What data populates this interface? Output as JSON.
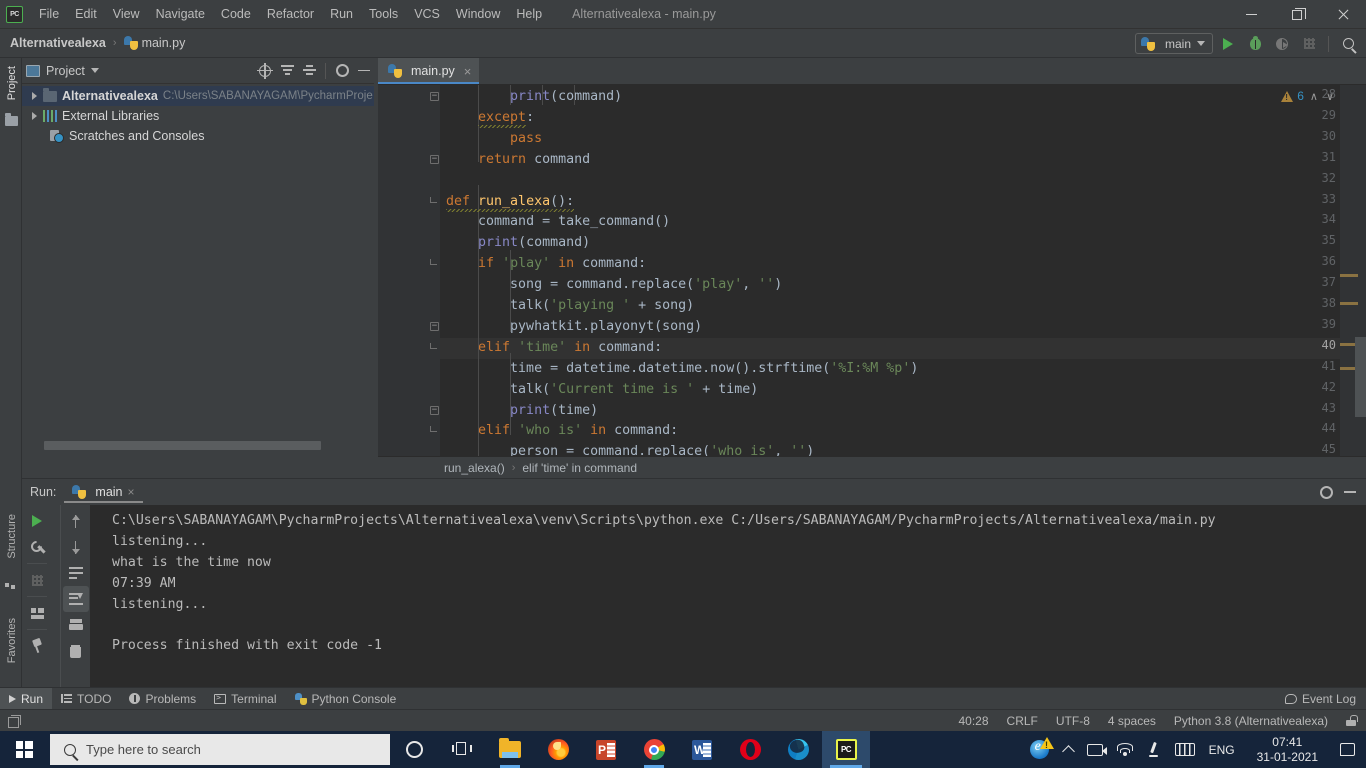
{
  "titlebar": {
    "logo": "PC",
    "menus": [
      "File",
      "Edit",
      "View",
      "Navigate",
      "Code",
      "Refactor",
      "Run",
      "Tools",
      "VCS",
      "Window",
      "Help"
    ],
    "window_title": "Alternativealexa - main.py",
    "minimize": "minimize-icon",
    "maximize": "maximize-icon",
    "close": "close-icon"
  },
  "navbar": {
    "project_crumb": "Alternativealexa",
    "separator": "›",
    "file_crumb": "main.py",
    "run_config": "main",
    "buttons": [
      "run-icon",
      "debug-icon",
      "coverage-icon",
      "profile-icon",
      "search-icon"
    ]
  },
  "left_strip": {
    "project_tab": "Project",
    "structure_tab": "Structure",
    "favorites_tab": "Favorites"
  },
  "project_panel": {
    "title": "Project",
    "header_buttons": [
      "locate-icon",
      "expand-all-icon",
      "collapse-all-icon",
      "settings-icon",
      "hide-icon"
    ],
    "tree": [
      {
        "label": "Alternativealexa",
        "path": "C:\\Users\\SABANAYAGAM\\PycharmProje",
        "icon": "folder-icon",
        "selected": true,
        "bold": true,
        "expandable": true
      },
      {
        "label": "External Libraries",
        "path": "",
        "icon": "library-icon",
        "selected": false,
        "bold": false,
        "expandable": true
      },
      {
        "label": "Scratches and Consoles",
        "path": "",
        "icon": "scratch-icon",
        "selected": false,
        "bold": false,
        "expandable": false
      }
    ]
  },
  "editor": {
    "tab_label": "main.py",
    "tab_close": "×",
    "warning_count": "6",
    "warning_up": "∧",
    "warning_down": "∨",
    "first_line_number": 28,
    "current_line": 40,
    "lines": [
      {
        "n": 28,
        "indent": 8,
        "tokens": [
          {
            "t": "print",
            "c": "bi"
          },
          {
            "t": "(command)",
            "c": "pl"
          }
        ],
        "fold": "full"
      },
      {
        "n": 29,
        "indent": 4,
        "tokens": [
          {
            "t": "except",
            "c": "kw"
          },
          {
            "t": ":",
            "c": "pl"
          }
        ],
        "fold": ""
      },
      {
        "n": 30,
        "indent": 8,
        "tokens": [
          {
            "t": "pass",
            "c": "kw"
          }
        ],
        "fold": ""
      },
      {
        "n": 31,
        "indent": 4,
        "tokens": [
          {
            "t": "return ",
            "c": "kw"
          },
          {
            "t": "command",
            "c": "pl"
          }
        ],
        "fold": "full"
      },
      {
        "n": 32,
        "indent": 0,
        "tokens": [],
        "fold": ""
      },
      {
        "n": 33,
        "indent": 0,
        "tokens": [
          {
            "t": "def ",
            "c": "kw"
          },
          {
            "t": "run_alexa",
            "c": "fn"
          },
          {
            "t": "():",
            "c": "pl"
          }
        ],
        "fold": "half"
      },
      {
        "n": 34,
        "indent": 4,
        "tokens": [
          {
            "t": "command = take_command()",
            "c": "pl"
          }
        ],
        "fold": ""
      },
      {
        "n": 35,
        "indent": 4,
        "tokens": [
          {
            "t": "print",
            "c": "bi"
          },
          {
            "t": "(command)",
            "c": "pl"
          }
        ],
        "fold": ""
      },
      {
        "n": 36,
        "indent": 4,
        "tokens": [
          {
            "t": "if ",
            "c": "kw"
          },
          {
            "t": "'play'",
            "c": "str"
          },
          {
            "t": " in",
            "c": "kw"
          },
          {
            "t": " command:",
            "c": "pl"
          }
        ],
        "fold": "half"
      },
      {
        "n": 37,
        "indent": 8,
        "tokens": [
          {
            "t": "song = command.replace(",
            "c": "pl"
          },
          {
            "t": "'play'",
            "c": "str"
          },
          {
            "t": ", ",
            "c": "pl"
          },
          {
            "t": "''",
            "c": "str"
          },
          {
            "t": ")",
            "c": "pl"
          }
        ],
        "fold": ""
      },
      {
        "n": 38,
        "indent": 8,
        "tokens": [
          {
            "t": "talk(",
            "c": "pl"
          },
          {
            "t": "'playing '",
            "c": "str"
          },
          {
            "t": " + song)",
            "c": "pl"
          }
        ],
        "fold": ""
      },
      {
        "n": 39,
        "indent": 8,
        "tokens": [
          {
            "t": "pywhatkit.playonyt(song)",
            "c": "pl"
          }
        ],
        "fold": "full"
      },
      {
        "n": 40,
        "indent": 4,
        "tokens": [
          {
            "t": "elif ",
            "c": "kw"
          },
          {
            "t": "'time'",
            "c": "str"
          },
          {
            "t": " in",
            "c": "kw"
          },
          {
            "t": " command:",
            "c": "pl"
          }
        ],
        "fold": "half"
      },
      {
        "n": 41,
        "indent": 8,
        "tokens": [
          {
            "t": "time = datetime.datetime.now().strftime(",
            "c": "pl"
          },
          {
            "t": "'%I:%M %p'",
            "c": "str"
          },
          {
            "t": ")",
            "c": "pl"
          }
        ],
        "fold": ""
      },
      {
        "n": 42,
        "indent": 8,
        "tokens": [
          {
            "t": "talk(",
            "c": "pl"
          },
          {
            "t": "'Current time is '",
            "c": "str"
          },
          {
            "t": " + time)",
            "c": "pl"
          }
        ],
        "fold": ""
      },
      {
        "n": 43,
        "indent": 8,
        "tokens": [
          {
            "t": "print",
            "c": "bi"
          },
          {
            "t": "(time)",
            "c": "pl"
          }
        ],
        "fold": "full"
      },
      {
        "n": 44,
        "indent": 4,
        "tokens": [
          {
            "t": "elif ",
            "c": "kw"
          },
          {
            "t": "'who is'",
            "c": "str"
          },
          {
            "t": " in",
            "c": "kw"
          },
          {
            "t": " command:",
            "c": "pl"
          }
        ],
        "fold": "half"
      },
      {
        "n": 45,
        "indent": 8,
        "tokens": [
          {
            "t": "person = command.replace(",
            "c": "pl"
          },
          {
            "t": "'who is'",
            "c": "str"
          },
          {
            "t": ", ",
            "c": "pl"
          },
          {
            "t": "''",
            "c": "str"
          },
          {
            "t": ")",
            "c": "pl"
          }
        ],
        "fold": ""
      }
    ]
  },
  "breadcrumb": {
    "items": [
      "run_alexa()",
      "elif 'time' in command"
    ],
    "separator": "›"
  },
  "run_panel": {
    "label": "Run:",
    "tab_name": "main",
    "tab_close": "×",
    "settings_icon": "gear-icon",
    "hide_icon": "hide-icon",
    "toolbar_left": [
      "rerun-icon",
      "wrench-icon",
      "stop-icon",
      "layout-icon",
      "pin-icon"
    ],
    "toolbar_right": [
      "arrow-up-icon",
      "arrow-down-icon",
      "soft-wrap-icon",
      "scroll-to-end-icon",
      "print-icon",
      "trash-icon"
    ],
    "console_lines": [
      "C:\\Users\\SABANAYAGAM\\PycharmProjects\\Alternativealexa\\venv\\Scripts\\python.exe C:/Users/SABANAYAGAM/PycharmProjects/Alternativealexa/main.py",
      "listening...",
      "what is the time now",
      "07:39 AM",
      "listening...",
      "",
      "Process finished with exit code -1"
    ]
  },
  "bottom_tabs": {
    "items": [
      {
        "label": "Run",
        "icon": "run-icon",
        "active": true
      },
      {
        "label": "TODO",
        "icon": "todo-icon",
        "active": false
      },
      {
        "label": "Problems",
        "icon": "problems-icon",
        "active": false
      },
      {
        "label": "Terminal",
        "icon": "terminal-icon",
        "active": false
      },
      {
        "label": "Python Console",
        "icon": "python-console-icon",
        "active": false
      }
    ],
    "event_log": "Event Log",
    "event_log_icon": "bubble-icon"
  },
  "statusbar": {
    "window_icon": "window-icon",
    "caret_position": "40:28",
    "line_separator": "CRLF",
    "encoding": "UTF-8",
    "indent": "4 spaces",
    "interpreter": "Python 3.8 (Alternativealexa)",
    "lock_icon": "lock-icon"
  },
  "taskbar": {
    "start_icon": "windows-start-icon",
    "search_placeholder": "Type here to search",
    "search_icon": "search-icon",
    "cortana_icon": "cortana-icon",
    "taskview_icon": "task-view-icon",
    "apps": [
      {
        "name": "file-explorer-icon",
        "active": false,
        "running": true
      },
      {
        "name": "firefox-icon",
        "active": false,
        "running": false
      },
      {
        "name": "powerpoint-icon",
        "active": false,
        "running": false
      },
      {
        "name": "chrome-icon",
        "active": false,
        "running": true
      },
      {
        "name": "word-icon",
        "active": false,
        "running": false
      },
      {
        "name": "opera-icon",
        "active": false,
        "running": false
      },
      {
        "name": "edge-icon",
        "active": false,
        "running": false
      },
      {
        "name": "pycharm-icon",
        "active": true,
        "running": false
      }
    ],
    "tray": {
      "ie_icon": "internet-explorer-warning-icon",
      "overflow_icon": "show-hidden-icons-icon",
      "camera_icon": "camera-icon",
      "wifi_icon": "wifi-icon",
      "pen_icon": "pen-icon",
      "keyboard_icon": "keyboard-icon",
      "language": "ENG",
      "time": "07:41",
      "date": "31-01-2021",
      "notification_icon": "notification-icon"
    }
  },
  "colors": {
    "accent": "#4a88c7",
    "ide_bg": "#3c3f41",
    "editor_bg": "#2b2b2b",
    "keyword": "#cc7832",
    "string": "#6a8759",
    "function": "#ffc66d",
    "builtin": "#8888c6",
    "plain": "#a9b7c6",
    "taskbar_bg": "#15243a"
  }
}
